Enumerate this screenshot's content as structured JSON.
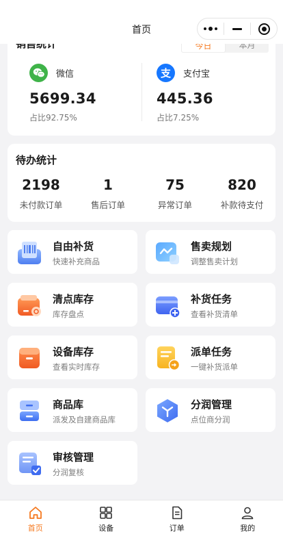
{
  "navbar": {
    "title": "首页"
  },
  "sales": {
    "title": "销售统计",
    "segments": [
      "今日",
      "本月"
    ],
    "wechat": {
      "name": "微信",
      "amount": "5699.34",
      "ratio": "占比92.75%"
    },
    "alipay": {
      "name": "支付宝",
      "icon_glyph": "支",
      "amount": "445.36",
      "ratio": "占比7.25%"
    }
  },
  "todo": {
    "title": "待办统计",
    "items": [
      {
        "value": "2198",
        "label": "未付款订单"
      },
      {
        "value": "1",
        "label": "售后订单"
      },
      {
        "value": "75",
        "label": "异常订单"
      },
      {
        "value": "820",
        "label": "补款待支付"
      }
    ]
  },
  "menu": [
    {
      "title": "自由补货",
      "sub": "快速补充商品",
      "icon": "barcode-scan-icon"
    },
    {
      "title": "售卖规划",
      "sub": "调整售卖计划",
      "icon": "trend-chart-icon"
    },
    {
      "title": "清点库存",
      "sub": "库存盘点",
      "icon": "wallet-icon"
    },
    {
      "title": "补货任务",
      "sub": "查看补货清单",
      "icon": "add-card-icon"
    },
    {
      "title": "设备库存",
      "sub": "查看实时库存",
      "icon": "box-icon"
    },
    {
      "title": "派单任务",
      "sub": "一键补货派单",
      "icon": "dispatch-doc-icon"
    },
    {
      "title": "商品库",
      "sub": "派发及自建商品库",
      "icon": "cabinet-icon"
    },
    {
      "title": "分润管理",
      "sub": "点位商分润",
      "icon": "hexagon-split-icon"
    },
    {
      "title": "审核管理",
      "sub": "分润复核",
      "icon": "review-check-icon"
    }
  ],
  "tabbar": [
    {
      "label": "首页",
      "icon": "home-icon",
      "active": true
    },
    {
      "label": "设备",
      "icon": "grid-icon",
      "active": false
    },
    {
      "label": "订单",
      "icon": "document-icon",
      "active": false
    },
    {
      "label": "我的",
      "icon": "user-icon",
      "active": false
    }
  ],
  "colors": {
    "accent": "#f5781e",
    "wechat": "#3fb349",
    "alipay": "#1677ff",
    "background": "#f3f3f5"
  }
}
